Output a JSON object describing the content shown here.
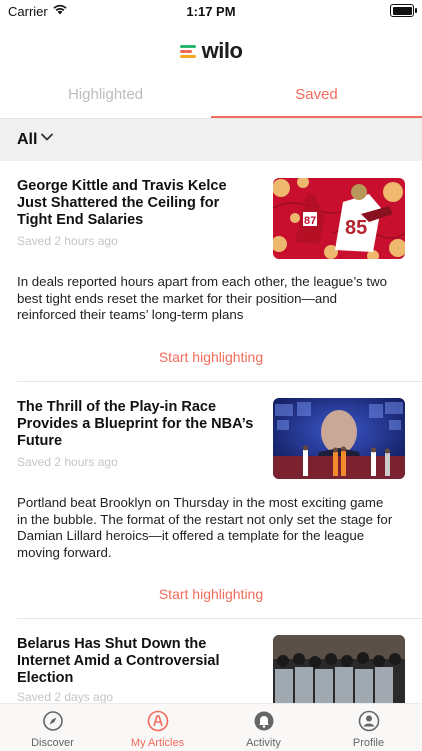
{
  "status_bar": {
    "carrier": "Carrier",
    "time": "1:17 PM"
  },
  "app": {
    "name": "wilo"
  },
  "tabs": [
    {
      "label": "Highlighted",
      "active": false
    },
    {
      "label": "Saved",
      "active": true
    }
  ],
  "filter": {
    "label": "All"
  },
  "articles": [
    {
      "title": "George Kittle and Travis Kelce Just Shattered the Ceiling for Tight End Salaries",
      "meta": "Saved 2 hours ago",
      "description": "In deals reported hours apart from each other, the league’s two best tight ends reset the market for their position—and reinforced their teams’ long-term plans",
      "cta": "Start highlighting"
    },
    {
      "title": "The Thrill of the Play-in Race Provides a Blueprint for the NBA’s Future",
      "meta": "Saved 2 hours ago",
      "description": "Portland beat Brooklyn on Thursday in the most exciting game in the bubble. The format of the restart not only set the stage for Damian Lillard heroics—it offered a template for the league moving forward.",
      "cta": "Start highlighting"
    },
    {
      "title": "Belarus Has Shut Down the Internet Amid a Controversial Election",
      "meta": "Saved 2 days ago"
    }
  ],
  "tabbar": [
    {
      "label": "Discover",
      "icon": "compass-icon",
      "active": false
    },
    {
      "label": "My Articles",
      "icon": "highlighter-icon",
      "active": true
    },
    {
      "label": "Activity",
      "icon": "bell-icon",
      "active": false
    },
    {
      "label": "Profile",
      "icon": "person-icon",
      "active": false
    }
  ],
  "colors": {
    "accent": "#f26b5b",
    "muted": "#bdbdbd",
    "filter_bg": "#f0f0f0"
  }
}
